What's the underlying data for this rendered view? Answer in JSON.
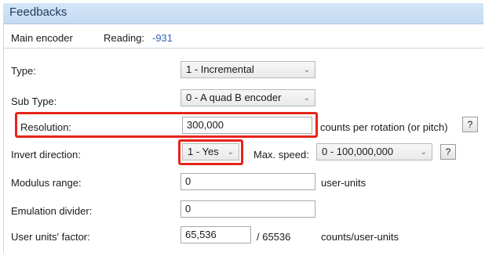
{
  "window": {
    "title": "Feedbacks"
  },
  "encoder": {
    "name": "Main encoder",
    "reading_label": "Reading:",
    "reading_value": "-931"
  },
  "rows": {
    "type": {
      "label": "Type:",
      "value": "1 - Incremental"
    },
    "sub_type": {
      "label": "Sub Type:",
      "value": "0 - A quad B encoder"
    },
    "resolution": {
      "label": "Resolution:",
      "value": "300,000",
      "unit": "counts per rotation (or pitch)",
      "help": "?"
    },
    "invert": {
      "label": "Invert direction:",
      "value": "1 - Yes",
      "max_speed_label": "Max. speed:",
      "max_speed_value": "0 - 100,000,000",
      "help": "?"
    },
    "modulus": {
      "label": "Modulus range:",
      "value": "0",
      "unit": "user-units"
    },
    "emulation": {
      "label": "Emulation divider:",
      "value": "0"
    },
    "user_units": {
      "label": "User units' factor:",
      "value": "65,536",
      "divisor": "/ 65536",
      "unit": "counts/user-units"
    }
  },
  "icons": {
    "dropdown": "chevron-down-icon"
  },
  "colors": {
    "highlight": "#e5251b",
    "title_bar": "#c4dbf3",
    "reading_value": "#2f67b6"
  }
}
